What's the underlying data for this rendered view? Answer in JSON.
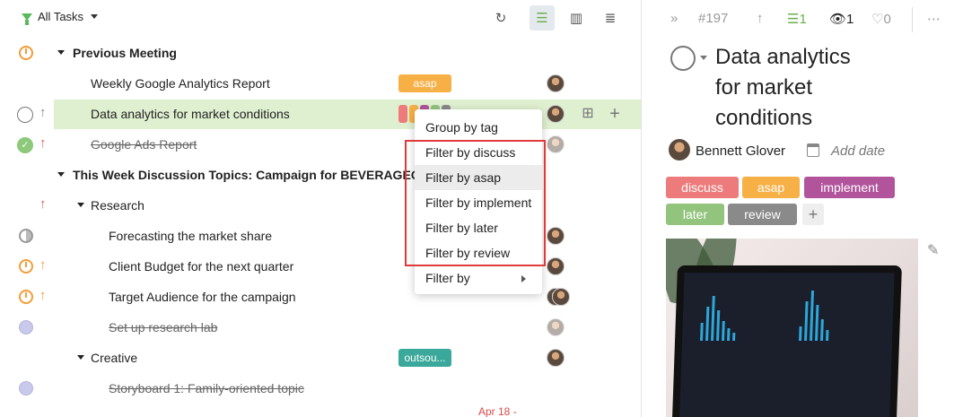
{
  "toolbar": {
    "filter_label": "All Tasks"
  },
  "task_list": {
    "rows": [
      {
        "title": "Previous Meeting",
        "kind": "group"
      },
      {
        "title": "Weekly Google Analytics Report",
        "tag": "asap"
      },
      {
        "title": "Data analytics for market conditions",
        "selected": true
      },
      {
        "title": "Google Ads Report",
        "done": true
      },
      {
        "title": "This Week Discussion Topics: Campaign for BEVERAGEO",
        "kind": "group"
      },
      {
        "title": "Research",
        "kind": "subgroup"
      },
      {
        "title": "Forecasting the market share"
      },
      {
        "title": "Client Budget for the next quarter"
      },
      {
        "title": "Target Audience for the campaign"
      },
      {
        "title": "Set up research lab",
        "done": true
      },
      {
        "title": "Creative",
        "kind": "subgroup",
        "tag": "outsou..."
      },
      {
        "title": "Storyboard 1: Family-oriented topic",
        "done": true
      }
    ],
    "partial_date": "Apr 18 -"
  },
  "dropdown": {
    "items": [
      {
        "label": "Group by tag"
      },
      {
        "label": "Filter by discuss"
      },
      {
        "label": "Filter by asap"
      },
      {
        "label": "Filter by implement"
      },
      {
        "label": "Filter by later"
      },
      {
        "label": "Filter by review"
      },
      {
        "label": "Filter by"
      }
    ]
  },
  "detail": {
    "task_id": "#197",
    "subtask_count": "1",
    "watchers": "1",
    "likes": "0",
    "title_lines": [
      "Data analytics",
      "for market",
      "conditions"
    ],
    "assignee": "Bennett Glover",
    "add_date": "Add date",
    "tags": [
      {
        "label": "discuss",
        "color": "#ee7b7b"
      },
      {
        "label": "asap",
        "color": "#f7b046"
      },
      {
        "label": "implement",
        "color": "#b1549c"
      },
      {
        "label": "later",
        "color": "#93c47d"
      },
      {
        "label": "review",
        "color": "#8a8a8a"
      }
    ]
  },
  "colors": {
    "accent_green": "#6ab04c",
    "selected_row": "#dff0d0",
    "highlight_red": "#e03a3a",
    "asap_tag": "#f7b046",
    "outsource_tag": "#3aa89a"
  }
}
